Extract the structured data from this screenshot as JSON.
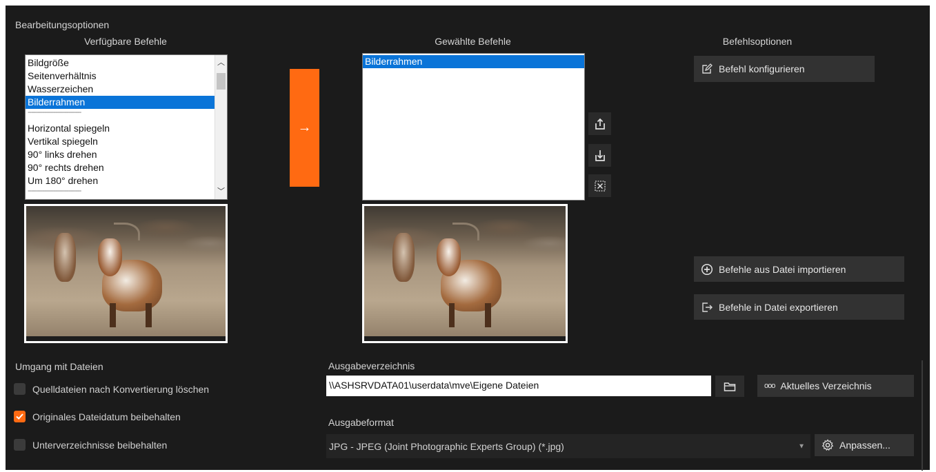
{
  "section_title": "Bearbeitungsoptionen",
  "available": {
    "title": "Verfügbare Befehle",
    "items": [
      {
        "label": "Bildgröße",
        "selected": false
      },
      {
        "label": "Seitenverhältnis",
        "selected": false
      },
      {
        "label": "Wasserzeichen",
        "selected": false
      },
      {
        "label": "Bilderrahmen",
        "selected": true
      },
      {
        "label": "-----------------------------",
        "separator": true
      },
      {
        "label": "Horizontal spiegeln",
        "selected": false
      },
      {
        "label": "Vertikal spiegeln",
        "selected": false
      },
      {
        "label": "90° links drehen",
        "selected": false
      },
      {
        "label": "90° rechts drehen",
        "selected": false
      },
      {
        "label": "Um 180° drehen",
        "selected": false
      },
      {
        "label": "-----------------------------",
        "separator": true
      }
    ]
  },
  "add_button_icon": "arrow-right-icon",
  "selected": {
    "title": "Gewählte Befehle",
    "items": [
      {
        "label": "Bilderrahmen",
        "selected": true
      }
    ]
  },
  "list_actions": [
    "move-up-icon",
    "move-down-icon",
    "remove-icon"
  ],
  "options": {
    "title": "Befehlsoptionen",
    "configure_label": "Befehl konfigurieren",
    "import_label": "Befehle aus Datei importieren",
    "export_label": "Befehle in Datei exportieren"
  },
  "file_handling": {
    "title": "Umgang mit Dateien",
    "checkboxes": [
      {
        "label": "Quelldateien nach Konvertierung löschen",
        "checked": false
      },
      {
        "label": "Originales Dateidatum beibehalten",
        "checked": true
      },
      {
        "label": "Unterverzeichnisse beibehalten",
        "checked": false
      }
    ]
  },
  "output": {
    "dir_title": "Ausgabeverzeichnis",
    "dir_value": "\\\\ASHSRVDATA01\\userdata\\mve\\Eigene Dateien",
    "current_dir_label": "Aktuelles Verzeichnis",
    "format_title": "Ausgabeformat",
    "format_value": "JPG - JPEG (Joint Photographic Experts Group) (*.jpg)",
    "customize_label": "Anpassen..."
  },
  "colors": {
    "accent": "#ff6a12",
    "selection": "#0a74d8",
    "panel": "#1b1b1b"
  }
}
